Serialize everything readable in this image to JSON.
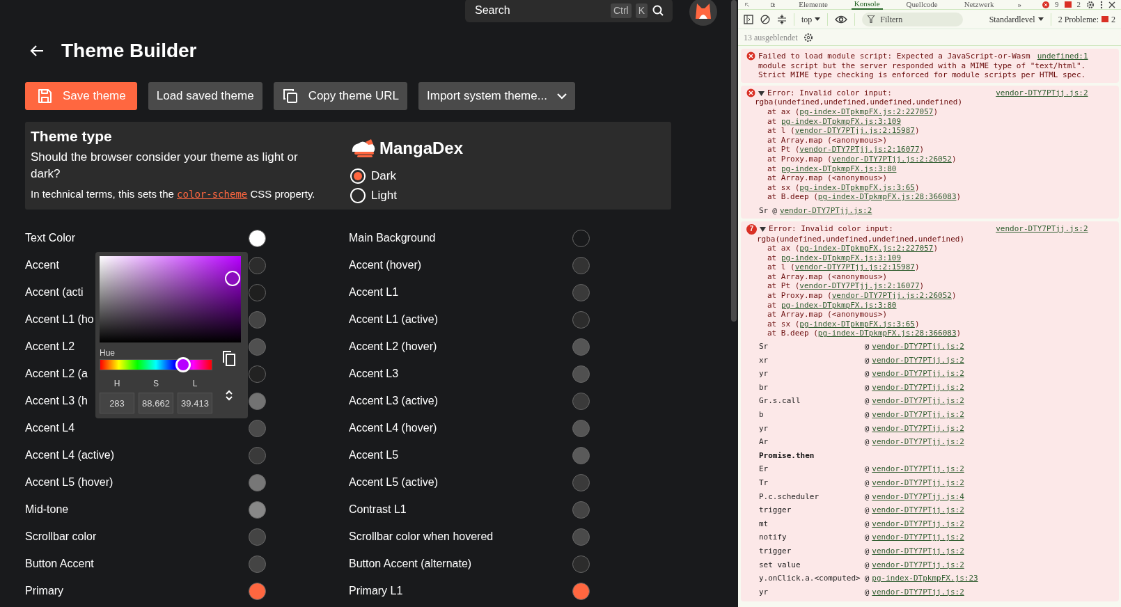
{
  "app": {
    "search": {
      "placeholder": "Search",
      "keys": [
        "Ctrl",
        "K"
      ]
    },
    "title": "Theme Builder",
    "actions": [
      {
        "label": "Save theme",
        "kind": "save"
      },
      {
        "label": "Load saved theme",
        "kind": "plain"
      },
      {
        "label": "Copy theme URL",
        "kind": "copy"
      },
      {
        "label": "Import system theme...",
        "kind": "dropdown"
      }
    ],
    "theme_type": {
      "title": "Theme type",
      "description": "Should the browser consider your theme as light or dark?",
      "note": {
        "before": "In technical terms, this sets the ",
        "code": "color-scheme",
        "after": " CSS property."
      },
      "logo": "MangaDex",
      "options": [
        {
          "label": "Dark",
          "selected": true
        },
        {
          "label": "Light",
          "selected": false
        }
      ]
    },
    "colors": [
      {
        "label": "Text Color",
        "color": "#ffffff"
      },
      {
        "label": "Main Background",
        "color": "#191a1c"
      },
      {
        "label": "Accent",
        "color": "#2c2c2c"
      },
      {
        "label": "Accent (hover)",
        "color": "#333333"
      },
      {
        "label": "Accent (acti",
        "color": "#1f1f1f"
      },
      {
        "label": "Accent L1",
        "color": "#3a3a3a"
      },
      {
        "label": "Accent L1 (ho",
        "color": "#444444"
      },
      {
        "label": "Accent L1 (active)",
        "color": "#2c2c2c"
      },
      {
        "label": "Accent L2",
        "color": "#505050"
      },
      {
        "label": "Accent L2 (hover)",
        "color": "#555555"
      },
      {
        "label": "Accent L2 (a",
        "color": "#222222"
      },
      {
        "label": "Accent L3",
        "color": "#505050"
      },
      {
        "label": "Accent L3 (h",
        "color": "#737373"
      },
      {
        "label": "Accent L3 (active)",
        "color": "#3a3a3a"
      },
      {
        "label": "Accent L4",
        "color": "#4a4a4a"
      },
      {
        "label": "Accent L4 (hover)",
        "color": "#555555"
      },
      {
        "label": "Accent L4 (active)",
        "color": "#3a3a3a"
      },
      {
        "label": "Accent L5",
        "color": "#5a5a5a"
      },
      {
        "label": "Accent L5 (hover)",
        "color": "#777777"
      },
      {
        "label": "Accent L5 (active)",
        "color": "#3a3a3a"
      },
      {
        "label": "Mid-tone",
        "color": "#888888"
      },
      {
        "label": "Contrast L1",
        "color": "#444444"
      },
      {
        "label": "Scrollbar color",
        "color": "#444444"
      },
      {
        "label": "Scrollbar color when hovered",
        "color": "#4a4a4a"
      },
      {
        "label": "Button Accent",
        "color": "#444444"
      },
      {
        "label": "Button Accent (alternate)",
        "color": "#2c2c2c"
      },
      {
        "label": "Primary",
        "color": "#ff6740"
      },
      {
        "label": "Primary L1",
        "color": "#ff6740"
      }
    ],
    "picker": {
      "label": "Hue",
      "level": 0.786,
      "fields": [
        {
          "label": "H",
          "value": "283"
        },
        {
          "label": "S",
          "value": "88.662"
        },
        {
          "label": "L",
          "value": "39.413"
        }
      ]
    }
  },
  "dev": {
    "tabs": [
      {
        "label": "Elemente",
        "selected": false
      },
      {
        "label": "Konsole",
        "selected": true
      },
      {
        "label": "Quellcode",
        "selected": false
      },
      {
        "label": "Netzwerk",
        "selected": false
      }
    ],
    "more": "»",
    "error_count": "9",
    "issue_count": "2",
    "context": "top",
    "filter": {
      "placeholder": "Filtern"
    },
    "level": "Standardlevel",
    "problems_label": "2 Probleme:",
    "problems_count": "2",
    "hidden": "13 ausgeblendet",
    "messages": [
      {
        "kind": "error",
        "lines": [
          "Failed to load module script: Expected a JavaScript-or-Wasm",
          "module script but the server responded with a MIME type of \"text/html\".",
          "Strict MIME type checking is enforced for module scripts per HTML spec."
        ],
        "source": "undefined:1"
      },
      {
        "kind": "trace",
        "expanded": true,
        "header": "Error: Invalid color input:",
        "source": "vendor-DTY7PTjj.js:2",
        "detail": "rgba(undefined,undefined,undefined,undefined)",
        "frames": [
          {
            "text": "at ax (",
            "link": "pg-index-DTpkmpFX.js:2:227057",
            "end": ")"
          },
          {
            "text": "at ",
            "link": "pg-index-DTpkmpFX.js:3:109"
          },
          {
            "text": "at l (",
            "link": "vendor-DTY7PTjj.js:2:15987",
            "end": ")"
          },
          {
            "text": "at Array.map (<anonymous>)"
          },
          {
            "text": "at Pt (",
            "link": "vendor-DTY7PTjj.js:2:16077",
            "end": ")"
          },
          {
            "text": "at Proxy.map (",
            "link": "vendor-DTY7PTjj.js:2:26052",
            "end": ")"
          },
          {
            "text": "at ",
            "link": "pg-index-DTpkmpFX.js:3:80"
          },
          {
            "text": "at Array.map (<anonymous>)"
          },
          {
            "text": "at sx (",
            "link": "pg-index-DTpkmpFX.js:3:65",
            "end": ")"
          },
          {
            "text": "at B.deep (",
            "link": "pg-index-DTpkmpFX.js:28:366083",
            "end": ")"
          }
        ],
        "calls": [
          {
            "kind": "frame",
            "fn": "Sr",
            "at": "@",
            "link": "vendor-DTY7PTjj.js:2"
          }
        ]
      },
      {
        "kind": "trace",
        "expanded": true,
        "repeat": "7",
        "header": "Error: Invalid color input:",
        "source": "vendor-DTY7PTjj.js:2",
        "detail": "rgba(undefined,undefined,undefined,undefined)",
        "frames": [
          {
            "text": "at ax (",
            "link": "pg-index-DTpkmpFX.js:2:227057",
            "end": ")"
          },
          {
            "text": "at ",
            "link": "pg-index-DTpkmpFX.js:3:109"
          },
          {
            "text": "at l (",
            "link": "vendor-DTY7PTjj.js:2:15987",
            "end": ")"
          },
          {
            "text": "at Array.map (<anonymous>)"
          },
          {
            "text": "at Pt (",
            "link": "vendor-DTY7PTjj.js:2:16077",
            "end": ")"
          },
          {
            "text": "at Proxy.map (",
            "link": "vendor-DTY7PTjj.js:2:26052",
            "end": ")"
          },
          {
            "text": "at ",
            "link": "pg-index-DTpkmpFX.js:3:80"
          },
          {
            "text": "at Array.map (<anonymous>)"
          },
          {
            "text": "at sx (",
            "link": "pg-index-DTpkmpFX.js:3:65",
            "end": ")"
          },
          {
            "text": "at B.deep (",
            "link": "pg-index-DTpkmpFX.js:28:366083",
            "end": ")"
          }
        ],
        "calls": [
          {
            "kind": "frame",
            "fn": "Sr",
            "at": "@",
            "link": "vendor-DTY7PTjj.js:2"
          },
          {
            "kind": "frame",
            "fn": "xr",
            "at": "@",
            "link": "vendor-DTY7PTjj.js:2"
          },
          {
            "kind": "frame",
            "fn": "yr",
            "at": "@",
            "link": "vendor-DTY7PTjj.js:2"
          },
          {
            "kind": "frame",
            "fn": "br",
            "at": "@",
            "link": "vendor-DTY7PTjj.js:2"
          },
          {
            "kind": "frame",
            "fn": "Gr.s.call",
            "at": "@",
            "link": "vendor-DTY7PTjj.js:2"
          },
          {
            "kind": "frame",
            "fn": "b",
            "at": "@",
            "link": "vendor-DTY7PTjj.js:2"
          },
          {
            "kind": "frame",
            "fn": "yr",
            "at": "@",
            "link": "vendor-DTY7PTjj.js:2"
          },
          {
            "kind": "frame",
            "fn": "Ar",
            "at": "@",
            "link": "vendor-DTY7PTjj.js:2"
          },
          {
            "kind": "async",
            "fn": "Promise.then"
          },
          {
            "kind": "frame",
            "fn": "Er",
            "at": "@",
            "link": "vendor-DTY7PTjj.js:2"
          },
          {
            "kind": "frame",
            "fn": "Tr",
            "at": "@",
            "link": "vendor-DTY7PTjj.js:2"
          },
          {
            "kind": "frame",
            "fn": "P.c.scheduler",
            "at": "@",
            "link": "vendor-DTY7PTjj.js:4"
          },
          {
            "kind": "frame",
            "fn": "trigger",
            "at": "@",
            "link": "vendor-DTY7PTjj.js:2"
          },
          {
            "kind": "frame",
            "fn": "mt",
            "at": "@",
            "link": "vendor-DTY7PTjj.js:2"
          },
          {
            "kind": "frame",
            "fn": "notify",
            "at": "@",
            "link": "vendor-DTY7PTjj.js:2"
          },
          {
            "kind": "frame",
            "fn": "trigger",
            "at": "@",
            "link": "vendor-DTY7PTjj.js:2"
          },
          {
            "kind": "frame",
            "fn": "set value",
            "at": "@",
            "link": "vendor-DTY7PTjj.js:2"
          },
          {
            "kind": "frame",
            "fn": "y.onClick.a.<computed>",
            "at": "@",
            "link": "pg-index-DTpkmpFX.js:23"
          },
          {
            "kind": "frame",
            "fn": "yr",
            "at": "@",
            "link": "vendor-DTY7PTjj.js:2"
          }
        ]
      }
    ]
  }
}
